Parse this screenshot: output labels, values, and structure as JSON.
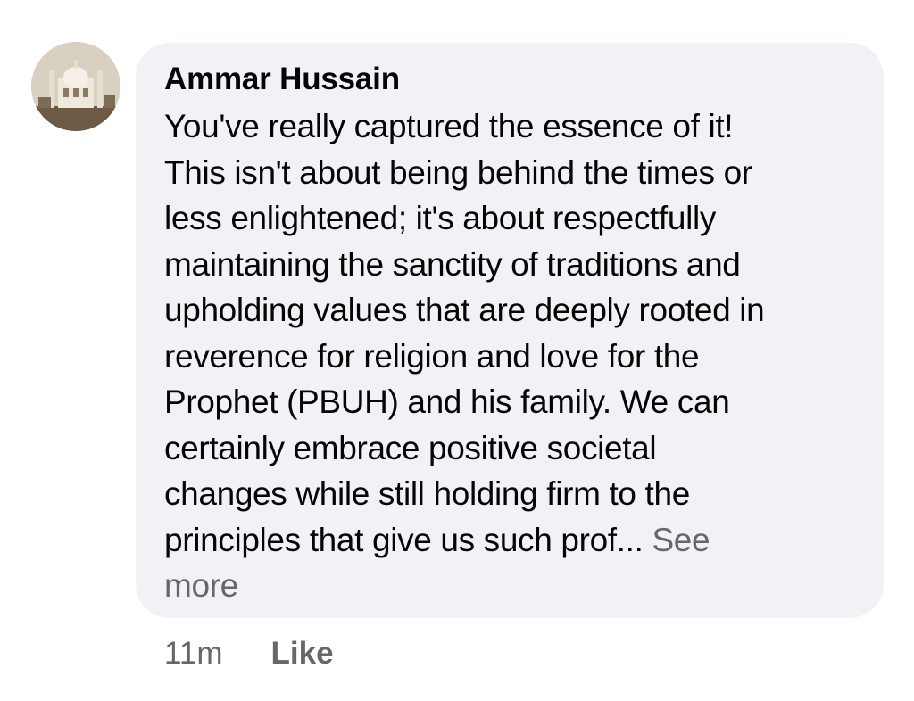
{
  "comment": {
    "author": "Ammar Hussain",
    "text_lines": [
      "You've really captured the essence of it!",
      "This isn't about being behind the times or",
      "less enlightened; it's about respectfully",
      "maintaining the sanctity of traditions and",
      "upholding values that are deeply rooted in",
      "reverence for religion and love for the",
      "Prophet (PBUH) and his family. We can",
      "certainly embrace positive societal",
      "changes while still holding firm to the",
      "principles that give us such prof..."
    ],
    "see_more_label": "See",
    "see_more_label_2": "more",
    "timestamp": "11m",
    "like_label": "Like"
  },
  "colors": {
    "bubble_bg": "#f0f2f5",
    "text": "#050505",
    "secondary_text": "#65676b"
  },
  "icons": {
    "avatar": "mosque-photo-avatar"
  }
}
